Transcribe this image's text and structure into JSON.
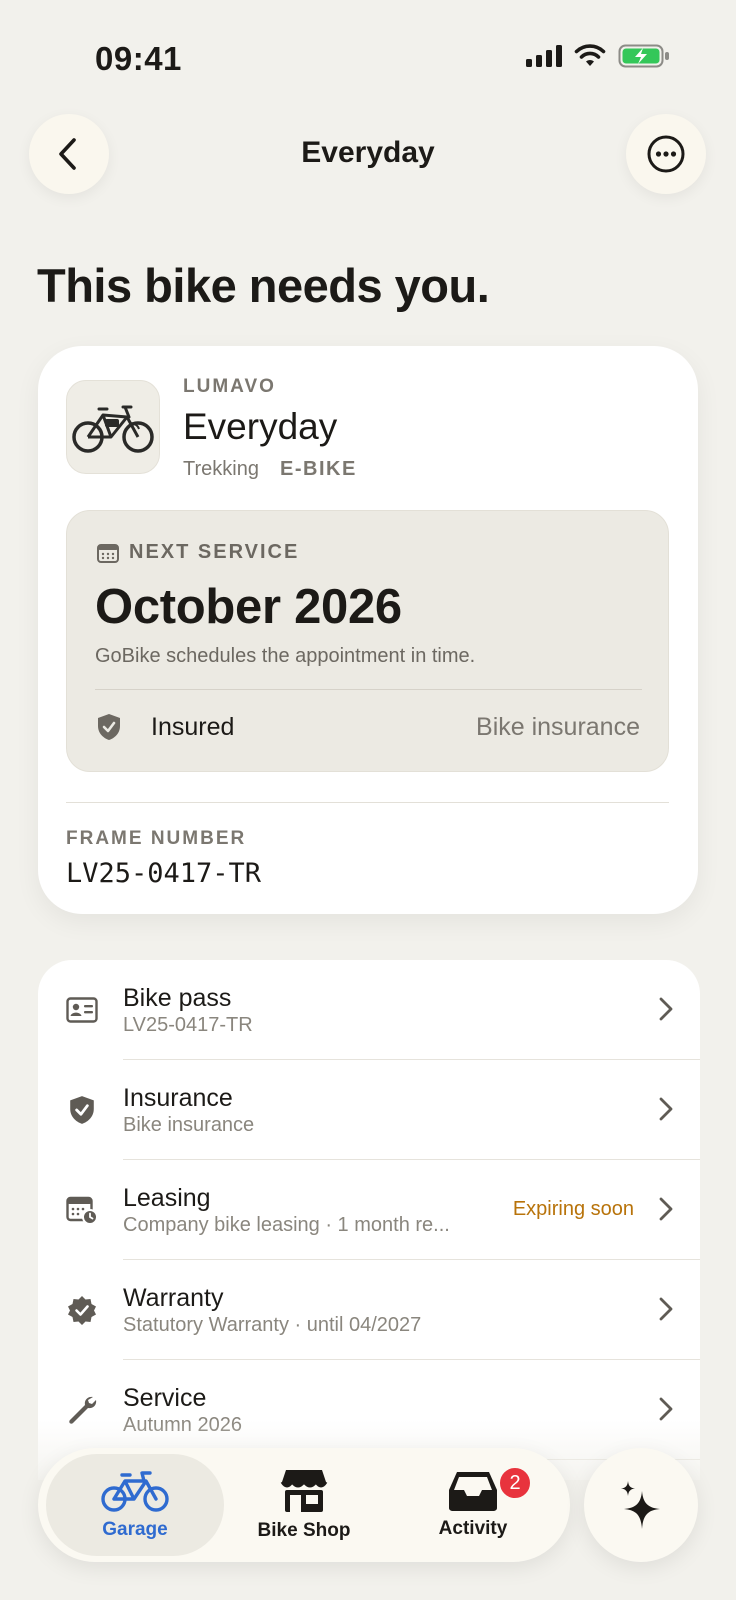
{
  "status_bar": {
    "time": "09:41"
  },
  "header": {
    "title": "Everyday"
  },
  "headline": "This bike needs you.",
  "bike": {
    "brand": "LUMAVO",
    "name": "Everyday",
    "type": "Trekking",
    "category": "E-BIKE",
    "next_service": {
      "label": "NEXT SERVICE",
      "date": "October 2026",
      "note": "GoBike schedules the appointment in time."
    },
    "insurance": {
      "status": "Insured",
      "name": "Bike insurance"
    },
    "frame": {
      "label": "FRAME NUMBER",
      "value": "LV25-0417-TR"
    }
  },
  "list": [
    {
      "title": "Bike pass",
      "subtitle": "LV25-0417-TR",
      "icon": "id-card-icon"
    },
    {
      "title": "Insurance",
      "subtitle": "Bike insurance",
      "icon": "shield-check-icon"
    },
    {
      "title": "Leasing",
      "subtitle": "Company bike leasing · 1 month re...",
      "badge": "Expiring soon",
      "icon": "calendar-clock-icon"
    },
    {
      "title": "Warranty",
      "subtitle": "Statutory Warranty · until 04/2027",
      "icon": "verified-badge-icon"
    },
    {
      "title": "Service",
      "subtitle": "Autumn 2026",
      "icon": "wrench-icon"
    }
  ],
  "tabbar": {
    "tabs": [
      {
        "label": "Garage",
        "active": true
      },
      {
        "label": "Bike Shop"
      },
      {
        "label": "Activity",
        "badge": "2"
      }
    ]
  },
  "colors": {
    "accent_blue": "#2f6bd0",
    "warning_orange": "#b8730a",
    "badge_red": "#e8333d",
    "battery_green": "#34c759"
  }
}
